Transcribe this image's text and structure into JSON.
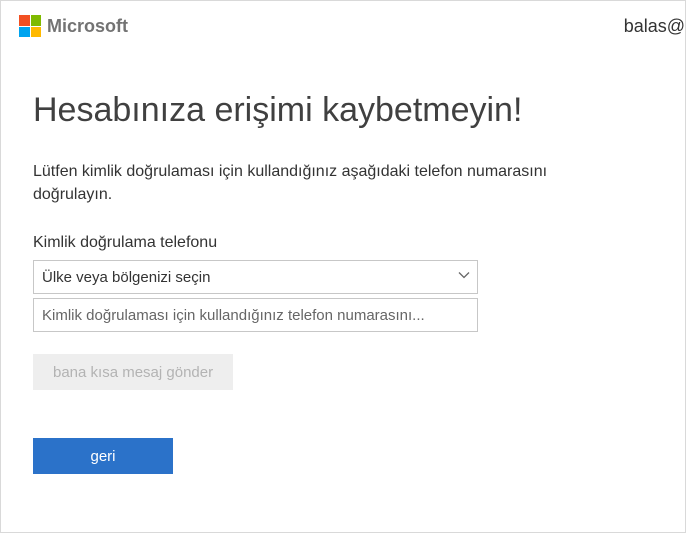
{
  "header": {
    "brand_text": "Microsoft",
    "user_text": "balas@"
  },
  "main": {
    "title": "Hesabınıza erişimi kaybetmeyin!",
    "instruction": "Lütfen kimlik doğrulaması için kullandığınız aşağıdaki telefon numarasını doğrulayın.",
    "phone_label": "Kimlik doğrulama telefonu",
    "country_select_value": "Ülke veya bölgenizi seçin",
    "phone_input_placeholder": "Kimlik doğrulaması için kullandığınız telefon numarasını...",
    "sms_button_label": "bana kısa mesaj gönder",
    "back_button_label": "geri"
  },
  "colors": {
    "primary": "#2b72c9",
    "disabled_bg": "#eeeeee",
    "disabled_fg": "#b3b3b3"
  }
}
